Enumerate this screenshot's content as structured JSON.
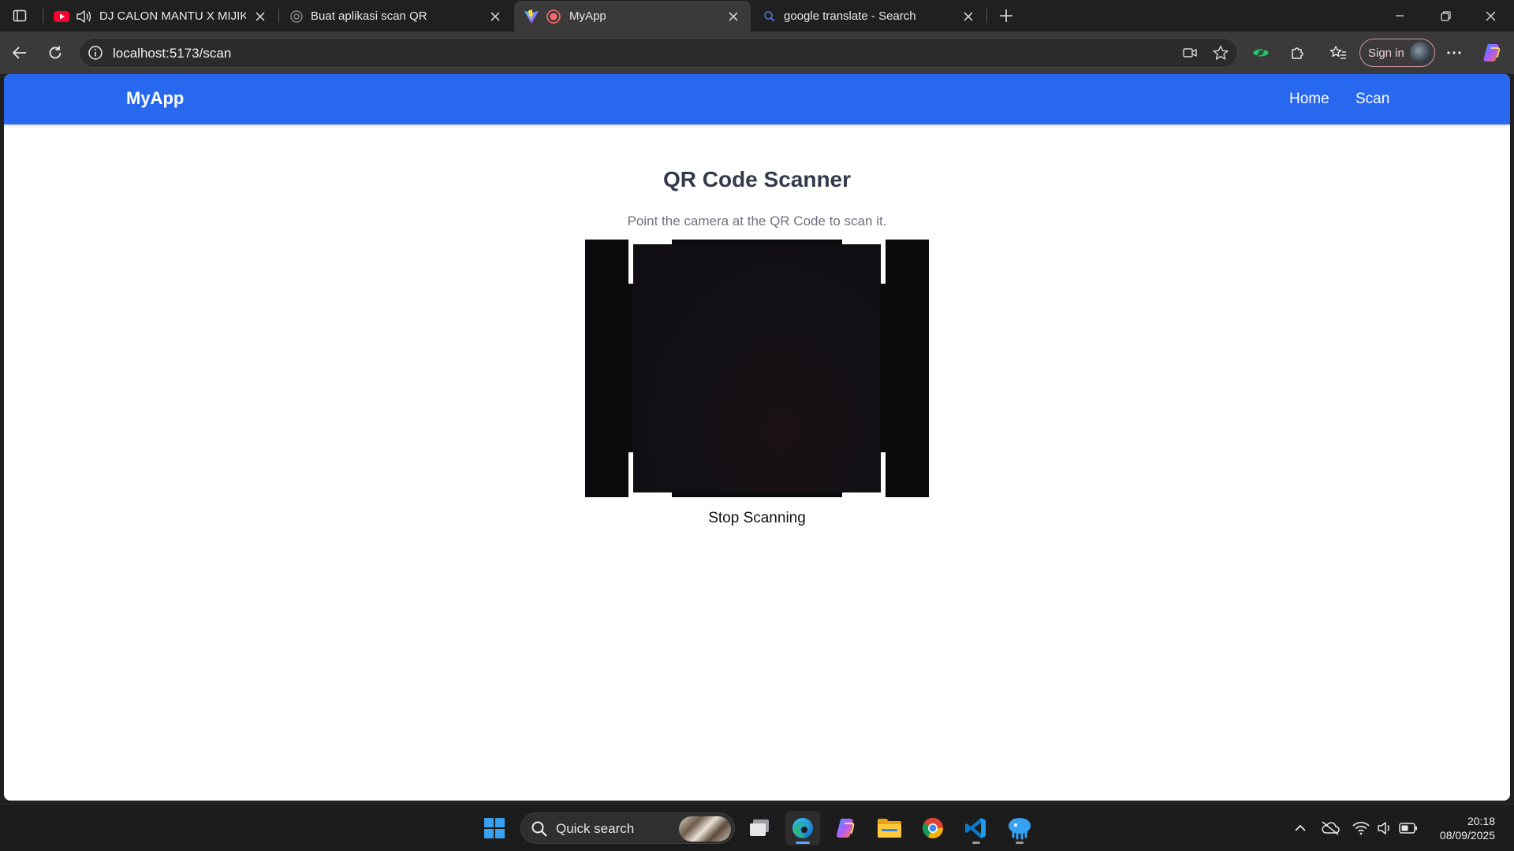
{
  "browser": {
    "tabs": [
      {
        "title": "DJ CALON MANTU X MIJIKU",
        "favicon": "youtube-icon",
        "audio": true,
        "active": false
      },
      {
        "title": "Buat aplikasi scan QR",
        "favicon": "chatgpt-icon",
        "active": false
      },
      {
        "title": "MyApp",
        "favicon": "vite-icon",
        "recording": true,
        "active": true
      },
      {
        "title": "google translate - Search",
        "favicon": "search-icon",
        "active": false
      }
    ],
    "address": {
      "url": "localhost:5173/scan"
    },
    "signin_label": "Sign in"
  },
  "app": {
    "brand": "MyApp",
    "nav": {
      "home": "Home",
      "scan": "Scan"
    },
    "title": "QR Code Scanner",
    "subtitle": "Point the camera at the QR Code to scan it.",
    "stop_label": "Stop Scanning"
  },
  "taskbar": {
    "search_placeholder": "Quick search",
    "apps": [
      "start-icon",
      "task-view-icon",
      "edge-icon",
      "copilot-icon",
      "file-explorer-icon",
      "chrome-icon",
      "vscode-icon",
      "app-icon"
    ],
    "clock": {
      "time": "20:18",
      "date": "08/09/2025"
    }
  },
  "colors": {
    "navbar": "#2868ee",
    "title": "#323a4b",
    "subtitle": "#6b7280"
  }
}
